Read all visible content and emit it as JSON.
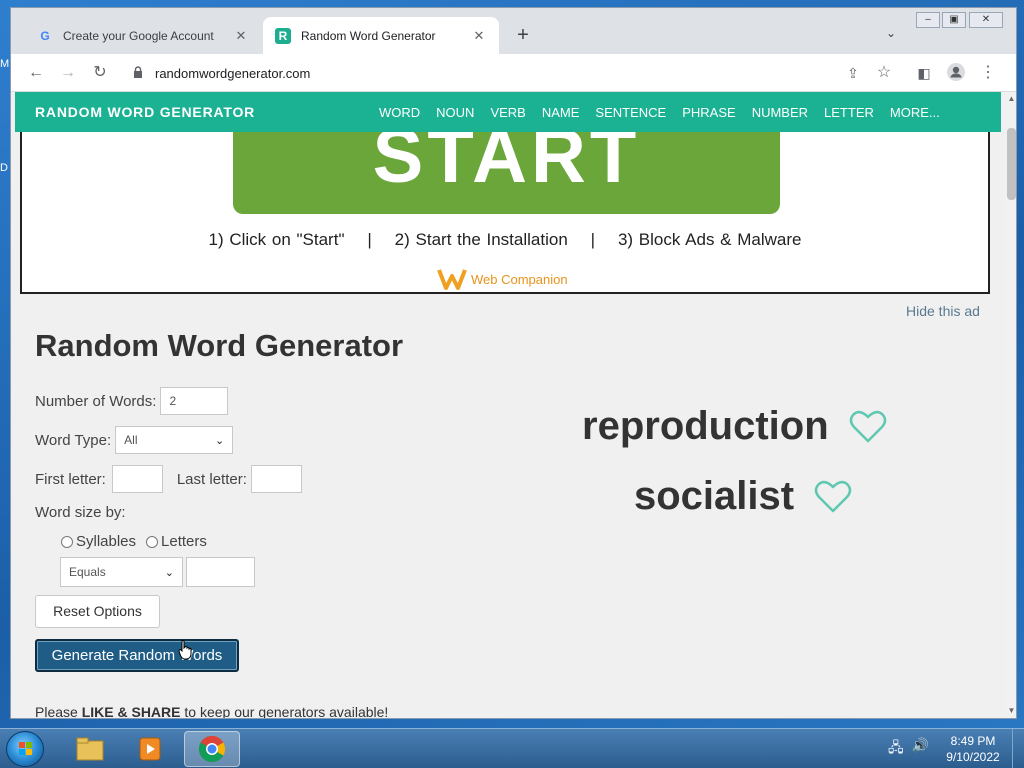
{
  "desktop": {
    "fragments": [
      "M",
      "D"
    ]
  },
  "browser": {
    "tabs": [
      {
        "title": "Create your Google Account",
        "favicon": "google-g-icon"
      },
      {
        "title": "Random Word Generator",
        "favicon": "rwg-logo-icon"
      }
    ],
    "url": "randomwordgenerator.com"
  },
  "site": {
    "logo": "RANDOM WORD GENERATOR",
    "nav": [
      "WORD",
      "NOUN",
      "VERB",
      "NAME",
      "SENTENCE",
      "PHRASE",
      "NUMBER",
      "LETTER",
      "MORE..."
    ]
  },
  "ad": {
    "start_label": "START",
    "steps": "1) Click on \"Start\"    |    2) Start the Installation    |    3) Block Ads & Malware",
    "brand": "Web Companion",
    "hide": "Hide this ad"
  },
  "main": {
    "title": "Random Word Generator",
    "number_of_words_label": "Number of Words:",
    "number_of_words_value": "2",
    "word_type_label": "Word Type:",
    "word_type_value": "All",
    "first_letter_label": "First letter:",
    "last_letter_label": "Last letter:",
    "word_size_label": "Word size by:",
    "syllables_label": "Syllables",
    "letters_label": "Letters",
    "size_compare_value": "Equals",
    "reset_label": "Reset Options",
    "generate_label": "Generate Random Words",
    "share_prefix": "Please ",
    "share_bold": "LIKE & SHARE",
    "share_suffix": " to keep our generators available!"
  },
  "results": [
    {
      "word": "reproduction"
    },
    {
      "word": "socialist"
    }
  ],
  "taskbar": {
    "time": "8:49 PM",
    "date": "9/10/2022"
  },
  "colors": {
    "site_accent": "#1bb294",
    "ad_green": "#6aa63a",
    "generate_button": "#1f5d86",
    "heart": "#5fc8b0"
  }
}
